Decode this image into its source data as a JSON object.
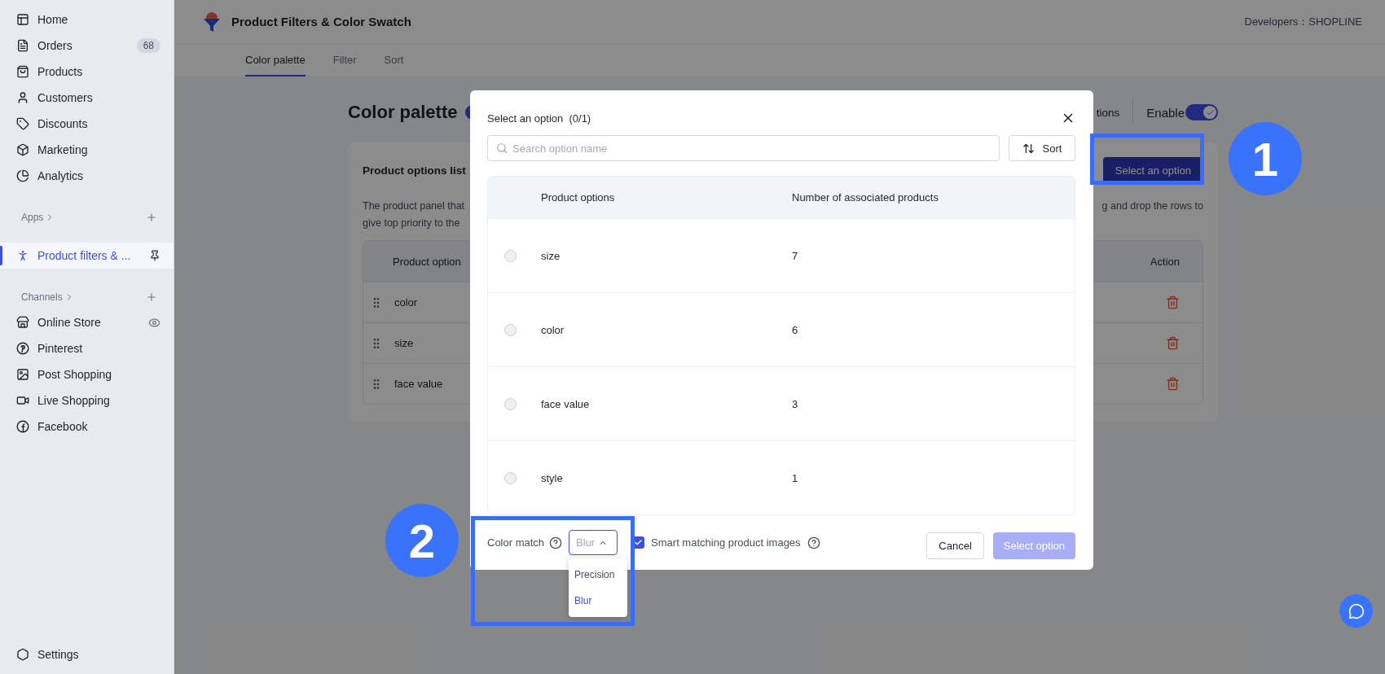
{
  "sidebar": {
    "main_items": [
      {
        "label": "Home"
      },
      {
        "label": "Orders",
        "badge": "68"
      },
      {
        "label": "Products"
      },
      {
        "label": "Customers"
      },
      {
        "label": "Discounts"
      },
      {
        "label": "Marketing"
      },
      {
        "label": "Analytics"
      }
    ],
    "apps_heading": "Apps",
    "apps": [
      {
        "label": "Product filters & ...",
        "selected": true
      }
    ],
    "channels_heading": "Channels",
    "channels": [
      {
        "label": "Online Store"
      },
      {
        "label": "Pinterest"
      },
      {
        "label": "Post Shopping"
      },
      {
        "label": "Live Shopping"
      },
      {
        "label": "Facebook"
      }
    ],
    "settings": "Settings"
  },
  "header": {
    "title": "Product Filters & Color Swatch",
    "developer": "Developers：SHOPLINE"
  },
  "tabs": [
    {
      "label": "Color palette",
      "selected": true
    },
    {
      "label": "Filter",
      "selected": false
    },
    {
      "label": "Sort",
      "selected": false
    }
  ],
  "page": {
    "title": "Color palette",
    "toolbar_text": "tions",
    "enable": {
      "label": "Enable",
      "on": true
    },
    "card": {
      "title": "Product options list",
      "button": "Select an option",
      "description_left": [
        "The product panel that",
        "give top priority to the"
      ],
      "description_right": "g and drop the rows to",
      "table": {
        "columns": [
          "Product option",
          "Action"
        ],
        "rows": [
          "color",
          "size",
          "face value"
        ]
      }
    }
  },
  "modal": {
    "title": "Select an option",
    "count": "(0/1)",
    "search": {
      "placeholder": "Search option name"
    },
    "sort_button": "Sort",
    "table": {
      "columns": [
        "Product options",
        "Number of associated products"
      ],
      "rows": [
        {
          "name": "size",
          "count": "7",
          "selected": false
        },
        {
          "name": "color",
          "count": "6",
          "selected": false
        },
        {
          "name": "face value",
          "count": "3",
          "selected": false
        },
        {
          "name": "style",
          "count": "1",
          "selected": false
        }
      ]
    },
    "footer": {
      "color_match": {
        "label": "Color match",
        "value": "Blur",
        "expanded": true,
        "options": [
          {
            "label": "Precision",
            "selected": false
          },
          {
            "label": "Blur",
            "selected": true
          }
        ]
      },
      "smart_matching": {
        "label": "Smart matching product images",
        "checked": true
      },
      "cancel": "Cancel",
      "confirm": {
        "label": "Select option",
        "disabled": true
      }
    }
  },
  "annotations": [
    {
      "label": "1"
    },
    {
      "label": "2"
    }
  ]
}
